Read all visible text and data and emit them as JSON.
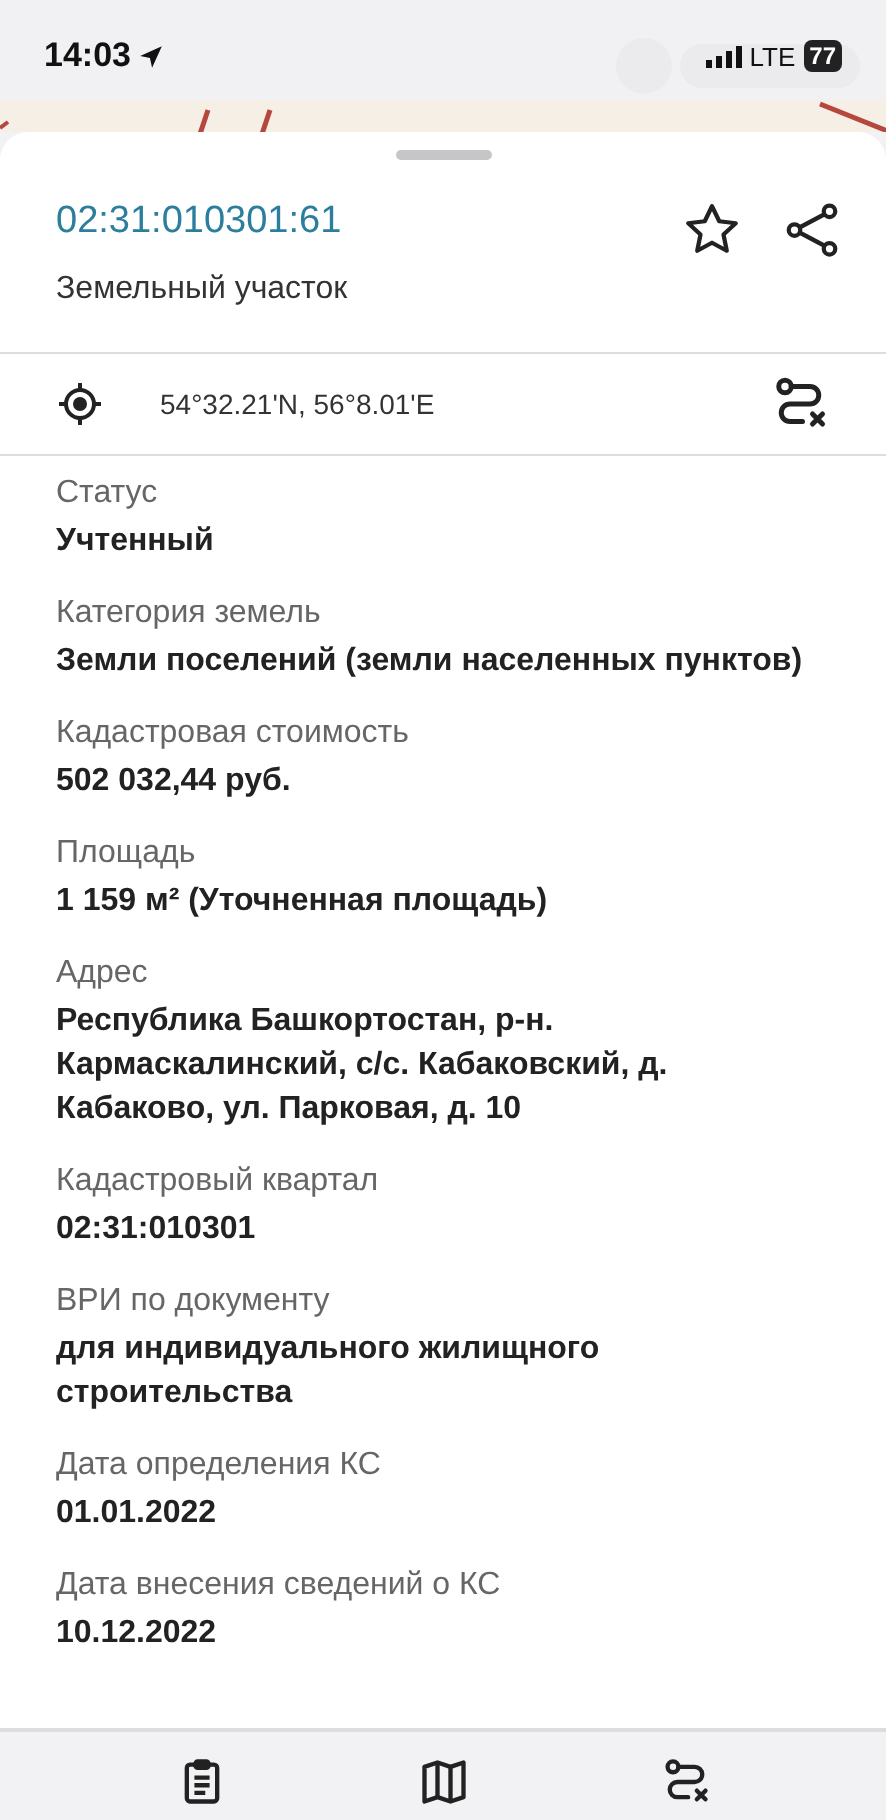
{
  "status_bar": {
    "time": "14:03",
    "network": "LTE",
    "battery": "77"
  },
  "card": {
    "title": "02:31:010301:61",
    "subtitle": "Земельный участок",
    "favorite": false,
    "coordinates": "54°32.21'N, 56°8.01'E",
    "fields": [
      {
        "label": "Статус",
        "value": "Учтенный"
      },
      {
        "label": "Категория земель",
        "value": "Земли поселений (земли населенных пунктов)"
      },
      {
        "label": "Кадастровая стоимость",
        "value": "502 032,44 руб."
      },
      {
        "label": "Площадь",
        "value": "1 159 м² (Уточненная площадь)"
      },
      {
        "label": "Адрес",
        "value": "Республика Башкортостан, р-н. Кармаскалинский, с/с. Кабаковский, д. Кабаково, ул. Парковая, д. 10"
      },
      {
        "label": "Кадастровый квартал",
        "value": "02:31:010301"
      },
      {
        "label": "ВРИ по документу",
        "value": "для индивидуального жилищного строительства"
      },
      {
        "label": "Дата определения КС",
        "value": "01.01.2022"
      },
      {
        "label": "Дата внесения сведений о КС",
        "value": "10.12.2022"
      }
    ]
  },
  "tab_bar": [
    {
      "kind": "details"
    },
    {
      "kind": "map"
    },
    {
      "kind": "route"
    }
  ]
}
